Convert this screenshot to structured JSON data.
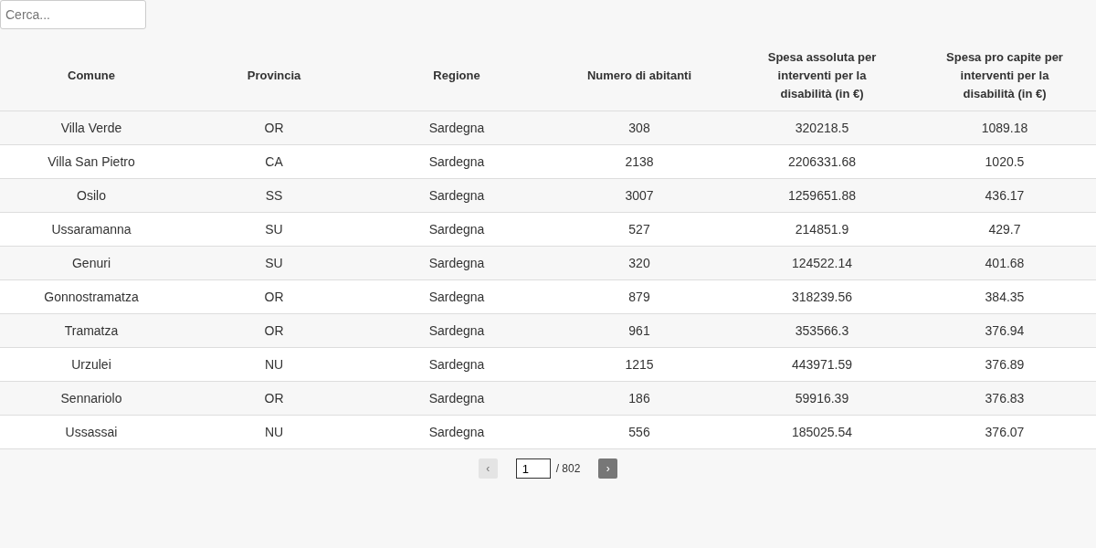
{
  "search": {
    "placeholder": "Cerca..."
  },
  "table": {
    "columns": [
      "Comune",
      "Provincia",
      "Regione",
      "Numero di abitanti",
      "Spesa assoluta per interventi per la disabilità (in €)",
      "Spesa pro capite per interventi per la disabilità (in €)"
    ],
    "rows": [
      [
        "Villa Verde",
        "OR",
        "Sardegna",
        "308",
        "320218.5",
        "1089.18"
      ],
      [
        "Villa San Pietro",
        "CA",
        "Sardegna",
        "2138",
        "2206331.68",
        "1020.5"
      ],
      [
        "Osilo",
        "SS",
        "Sardegna",
        "3007",
        "1259651.88",
        "436.17"
      ],
      [
        "Ussaramanna",
        "SU",
        "Sardegna",
        "527",
        "214851.9",
        "429.7"
      ],
      [
        "Genuri",
        "SU",
        "Sardegna",
        "320",
        "124522.14",
        "401.68"
      ],
      [
        "Gonnostramatza",
        "OR",
        "Sardegna",
        "879",
        "318239.56",
        "384.35"
      ],
      [
        "Tramatza",
        "OR",
        "Sardegna",
        "961",
        "353566.3",
        "376.94"
      ],
      [
        "Urzulei",
        "NU",
        "Sardegna",
        "1215",
        "443971.59",
        "376.89"
      ],
      [
        "Sennariolo",
        "OR",
        "Sardegna",
        "186",
        "59916.39",
        "376.83"
      ],
      [
        "Ussassai",
        "NU",
        "Sardegna",
        "556",
        "185025.54",
        "376.07"
      ]
    ]
  },
  "pagination": {
    "prev": {
      "label": "‹",
      "disabled": true
    },
    "page": "1",
    "total": "/ 802",
    "next": {
      "label": "›",
      "disabled": false
    }
  }
}
